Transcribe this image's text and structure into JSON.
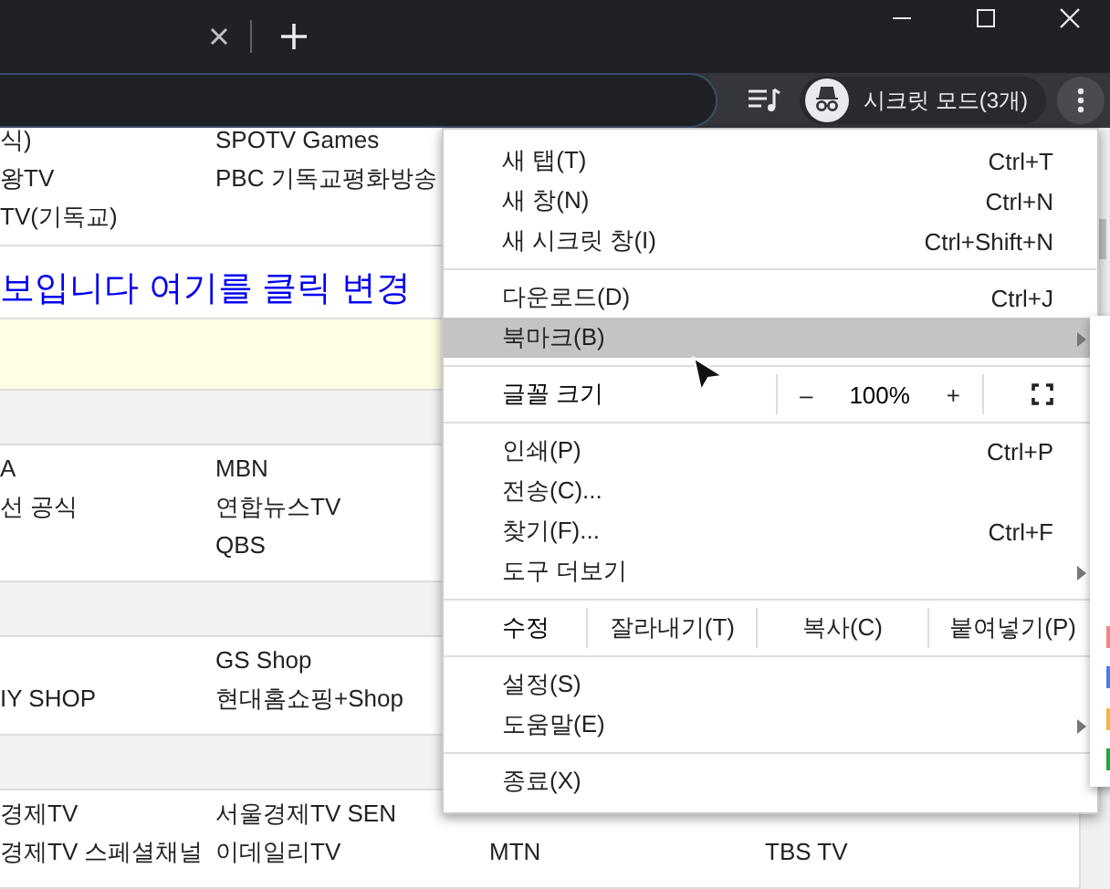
{
  "toolbar": {
    "profile_label": "시크릿 모드(3개)"
  },
  "page": {
    "blocks": [
      {
        "kind": "rows",
        "rows": [
          {
            "column_1": "식)",
            "column_2": "SPOTV Games"
          },
          {
            "column_1": "왕TV",
            "column_2": "PBC 기독교평화방송"
          },
          {
            "column_1": "TV(기독교)"
          }
        ]
      },
      {
        "kind": "notice",
        "text": "보입니다 여기를 클릭 변경"
      },
      {
        "kind": "highlight"
      },
      {
        "kind": "header"
      },
      {
        "kind": "rows",
        "rows": [
          {
            "column_1": "A",
            "column_2": "MBN"
          },
          {
            "column_1": "선 공식",
            "column_2": "연합뉴스TV"
          },
          {
            "column_2": "QBS"
          }
        ]
      },
      {
        "kind": "header"
      },
      {
        "kind": "rows",
        "rows": [
          {
            "column_2": "GS Shop"
          },
          {
            "column_1": "IY SHOP",
            "column_2": "현대홈쇼핑+Shop"
          }
        ]
      },
      {
        "kind": "header"
      },
      {
        "kind": "rows",
        "rows": [
          {
            "column_1": "경제TV",
            "column_2": "서울경제TV SEN"
          },
          {
            "column_1": "경제TV 스페셜채널",
            "column_2": "이데일리TV",
            "column_3": "MTN",
            "column_4": "TBS TV"
          }
        ]
      }
    ]
  },
  "menu": {
    "items": [
      {
        "kind": "item",
        "label": "새 탭(T)",
        "shortcut": "Ctrl+T",
        "submenu": false,
        "selected": false
      },
      {
        "kind": "item",
        "label": "새 창(N)",
        "shortcut": "Ctrl+N",
        "submenu": false,
        "selected": false
      },
      {
        "kind": "item",
        "label": "새 시크릿 창(I)",
        "shortcut": "Ctrl+Shift+N",
        "submenu": false,
        "selected": false
      },
      {
        "kind": "separator"
      },
      {
        "kind": "item",
        "label": "다운로드(D)",
        "shortcut": "Ctrl+J",
        "submenu": false,
        "selected": false
      },
      {
        "kind": "item",
        "label": "북마크(B)",
        "submenu": true,
        "selected": true
      },
      {
        "kind": "separator"
      },
      {
        "kind": "zoom",
        "label": "글꼴 크기",
        "minus": "–",
        "value": "100%",
        "plus": "+"
      },
      {
        "kind": "separator"
      },
      {
        "kind": "item",
        "label": "인쇄(P)",
        "shortcut": "Ctrl+P",
        "submenu": false,
        "selected": false
      },
      {
        "kind": "item",
        "label": "전송(C)...",
        "submenu": false,
        "selected": false
      },
      {
        "kind": "item",
        "label": "찾기(F)...",
        "shortcut": "Ctrl+F",
        "submenu": false,
        "selected": false
      },
      {
        "kind": "item",
        "label": "도구 더보기",
        "submenu": true,
        "selected": false
      },
      {
        "kind": "separator"
      },
      {
        "kind": "edit",
        "label": "수정",
        "buttons": [
          "잘라내기(T)",
          "복사(C)",
          "붙여넣기(P)"
        ]
      },
      {
        "kind": "separator"
      },
      {
        "kind": "item",
        "label": "설정(S)",
        "submenu": false,
        "selected": false
      },
      {
        "kind": "item",
        "label": "도움말(E)",
        "submenu": true,
        "selected": false
      },
      {
        "kind": "separator"
      },
      {
        "kind": "item",
        "label": "종료(X)",
        "submenu": false,
        "selected": false
      }
    ]
  }
}
